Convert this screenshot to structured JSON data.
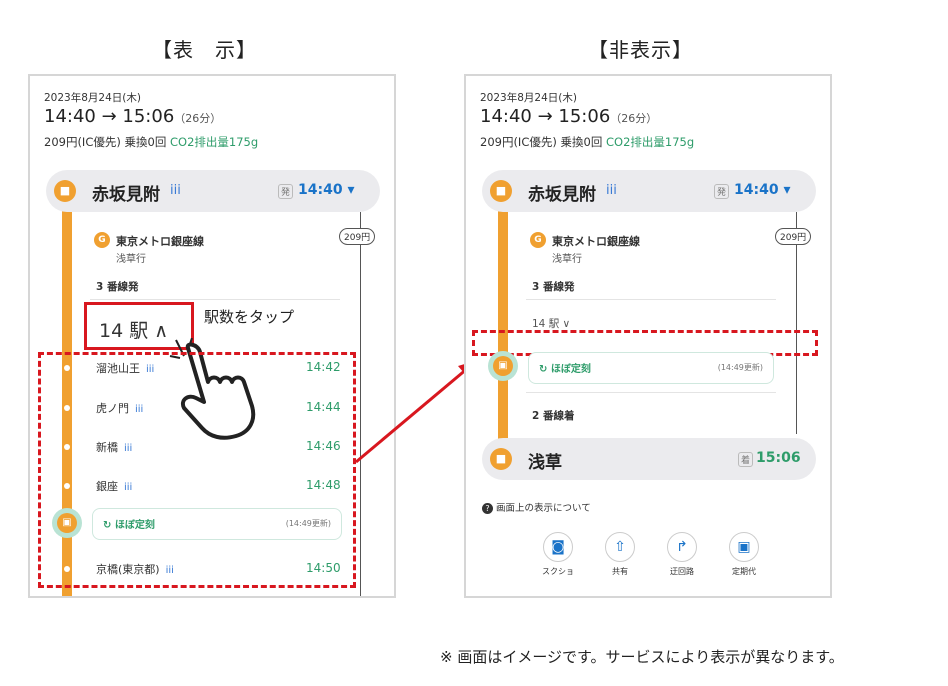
{
  "left": {
    "heading": "【表　示】",
    "date": "2023年8月24日(木)",
    "times": "14:40 → 15:06",
    "duration": "（26分）",
    "fare_text": "209円(IC優先)  乗換0回",
    "co2": "CO2排出量175g",
    "origin": {
      "name": "赤坂見附",
      "badge": "発",
      "time": "14:40 ▾"
    },
    "fare_tag": "209円",
    "line_name": "東京メトロ銀座線",
    "line_dir": "浅草行",
    "platform": "3 番線発",
    "toggle_label": "14 駅 ∧",
    "tap_hint": "駅数をタップ",
    "stops": [
      {
        "name": "溜池山王",
        "time": "14:42"
      },
      {
        "name": "虎ノ門",
        "time": "14:44"
      },
      {
        "name": "新橋",
        "time": "14:46"
      },
      {
        "name": "銀座",
        "time": "14:48"
      },
      {
        "name": "京橋(東京都)",
        "time": "14:50"
      }
    ],
    "ontime": {
      "label": "ほぼ定刻",
      "updated": "(14:49更新)"
    }
  },
  "right": {
    "heading": "【非表示】",
    "date": "2023年8月24日(木)",
    "times": "14:40 → 15:06",
    "duration": "（26分）",
    "fare_text": "209円(IC優先)  乗換0回",
    "co2": "CO2排出量175g",
    "origin": {
      "name": "赤坂見附",
      "badge": "発",
      "time": "14:40 ▾"
    },
    "fare_tag": "209円",
    "line_name": "東京メトロ銀座線",
    "line_dir": "浅草行",
    "platform": "3 番線発",
    "toggle_label": "14 駅 ∨",
    "ontime": {
      "label": "ほぼ定刻",
      "updated": "(14:49更新)"
    },
    "arrive_platform": "2 番線着",
    "dest": {
      "name": "浅草",
      "badge": "着",
      "time": "15:06"
    },
    "help": "画面上の表示について",
    "actions": [
      {
        "label": "スクショ",
        "icon": "camera-icon"
      },
      {
        "label": "共有",
        "icon": "share-icon"
      },
      {
        "label": "迂回路",
        "icon": "detour-icon"
      },
      {
        "label": "定期代",
        "icon": "commuter-pass-icon"
      }
    ]
  },
  "footnote": "※ 画面はイメージです。サービスにより表示が異なります。",
  "colors": {
    "accent_red": "#d8171f",
    "line_orange": "#f0a030",
    "time_blue": "#1a73c8",
    "green": "#2e9c6a"
  }
}
